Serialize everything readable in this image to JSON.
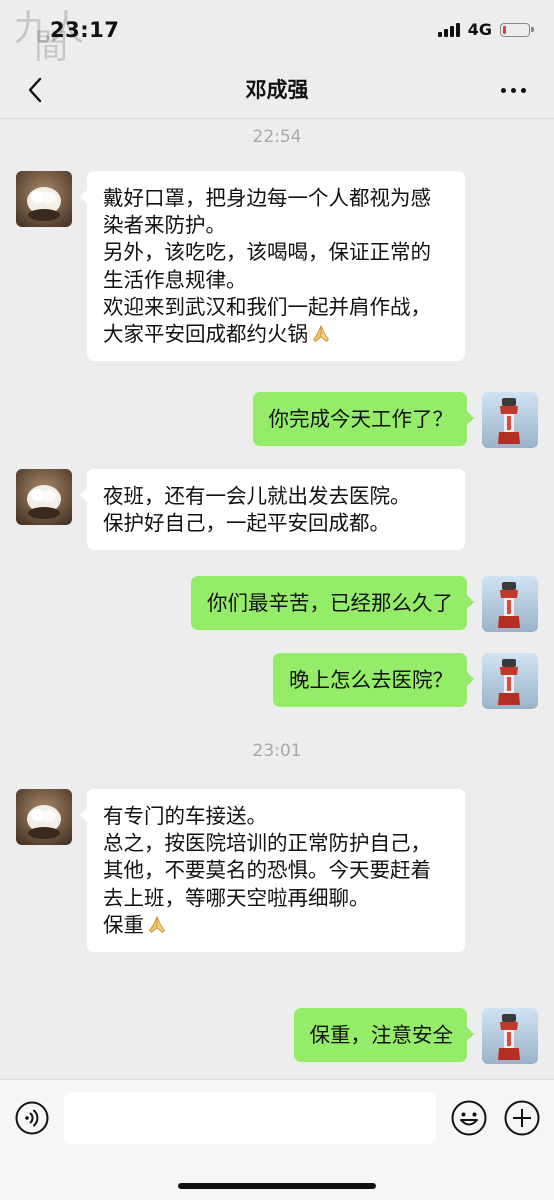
{
  "status_bar": {
    "time": "23:17",
    "network": "4G",
    "battery_level": 0.12,
    "watermark_chars": [
      "九",
      "人",
      "間"
    ]
  },
  "nav": {
    "title": "邓成强"
  },
  "messages": [
    {
      "type": "timestamp",
      "text": "22:54"
    },
    {
      "type": "message",
      "side": "in",
      "text": "戴好口罩，把身边每一个人都视为感染者来防护。\n另外，该吃吃，该喝喝，保证正常的生活作息规律。\n欢迎来到武汉和我们一起并肩作战，大家平安回成都约火锅",
      "emoji": "pray-icon"
    },
    {
      "type": "message",
      "side": "out",
      "text": "你完成今天工作了？"
    },
    {
      "type": "message",
      "side": "in",
      "text": "夜班，还有一会儿就出发去医院。\n保护好自己，一起平安回成都。"
    },
    {
      "type": "message",
      "side": "out",
      "text": "你们最辛苦，已经那么久了"
    },
    {
      "type": "message",
      "side": "out",
      "text": "晚上怎么去医院？"
    },
    {
      "type": "timestamp",
      "text": "23:01"
    },
    {
      "type": "message",
      "side": "in",
      "text": "有专门的车接送。\n总之，按医院培训的正常防护自己，其他，不要莫名的恐惧。今天要赶着去上班，等哪天空啦再细聊。\n保重",
      "emoji": "pray-icon"
    },
    {
      "type": "message",
      "side": "out",
      "text": "保重，注意安全"
    }
  ],
  "input_bar": {
    "text_value": "",
    "icons": [
      "voice-icon",
      "emoji-icon",
      "plus-icon"
    ]
  },
  "colors": {
    "background": "#ededed",
    "incoming_bubble": "#ffffff",
    "outgoing_bubble": "#95ec69",
    "timestamp": "#a8a8a8"
  }
}
